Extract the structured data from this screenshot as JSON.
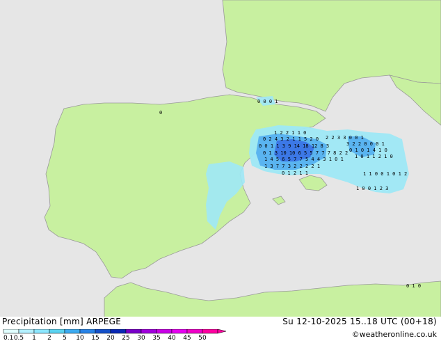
{
  "legend": {
    "title": "Precipitation [mm]",
    "model": "ARPEGE",
    "ticks": [
      "0.1",
      "0.5",
      "1",
      "2",
      "5",
      "10",
      "15",
      "20",
      "25",
      "30",
      "35",
      "40",
      "45",
      "50"
    ],
    "colors": [
      "#e0ffff",
      "#b4f0ff",
      "#8ce6ff",
      "#5ad2f0",
      "#3caaf0",
      "#2882e6",
      "#1450c8",
      "#0a28b4",
      "#7800c8",
      "#a000dc",
      "#c800e6",
      "#e600f0",
      "#f000c8",
      "#ff00a0"
    ]
  },
  "valid_time": "Su 12-10-2025 15..18 UTC (00+18)",
  "credit": "©weatheronline.co.uk",
  "colors": {
    "sea": "#e6e6e6",
    "land": "#c8f0a0",
    "border": "#999999",
    "light_precip": "#9ee8f6",
    "mid_precip": "#5ab4f0",
    "heavy_precip": "#3c78e6"
  },
  "grid_values": [
    {
      "label": "0 0 0  1"
    },
    {
      "label": "0"
    },
    {
      "label": "1 2 2 1 1 0"
    },
    {
      "label": "0 2 4 3 2 1 1 5 2 0"
    },
    {
      "label": "0 0 1 1 3 9 14 18 12 8 3"
    },
    {
      "label": "0 1 3 10 10 6 5 5 7 7 7 8 2 2"
    },
    {
      "label": "1 4 5 6 5 7 7 5 4 4 3 1 0 1"
    },
    {
      "label": "1 3 7 7 3 2 2 2 2 1"
    },
    {
      "label": "0 1 2 1 1"
    },
    {
      "label": "2 2 3 3 0 0 1"
    },
    {
      "label": "3 2 2 0 0 0 1"
    },
    {
      "label": "0 1 0 1 4 1 0"
    },
    {
      "label": "1 0 1 1 2 1 0"
    },
    {
      "label": "1 1 0 0 1 0 1 2"
    },
    {
      "label": "1 0 0 1 2 3"
    },
    {
      "label": "0 1 0"
    }
  ]
}
